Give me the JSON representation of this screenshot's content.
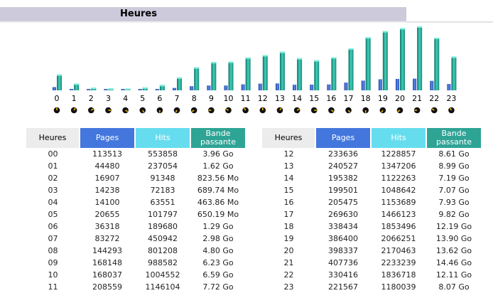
{
  "title": "Heures",
  "colors": {
    "pages": "#4477dd",
    "hits": "#2ea495",
    "header_bar": "#cccadb"
  },
  "columns": {
    "hour": "Heures",
    "pages": "Pages",
    "hits": "Hits",
    "bandwidth": "Bande passante"
  },
  "chart_data": {
    "type": "bar",
    "categories": [
      "0",
      "1",
      "2",
      "3",
      "4",
      "5",
      "6",
      "7",
      "8",
      "9",
      "10",
      "11",
      "12",
      "13",
      "14",
      "15",
      "16",
      "17",
      "18",
      "19",
      "20",
      "21",
      "22",
      "23"
    ],
    "series": [
      {
        "name": "Pages",
        "values": [
          113513,
          44480,
          16907,
          14238,
          14100,
          20655,
          36318,
          83272,
          144293,
          168148,
          168037,
          208559,
          233636,
          240527,
          195382,
          199501,
          205475,
          269630,
          338434,
          386400,
          398337,
          407736,
          330416,
          221567
        ]
      },
      {
        "name": "Hits",
        "values": [
          553858,
          237054,
          91348,
          72183,
          63551,
          101797,
          189680,
          450942,
          801208,
          988582,
          1004552,
          1146104,
          1228857,
          1347206,
          1122263,
          1048642,
          1153689,
          1466123,
          1853496,
          2066251,
          2170463,
          2233239,
          1836718,
          1180039
        ]
      }
    ],
    "icon": "clock-icon"
  },
  "left_rows": [
    {
      "hour": "00",
      "pages": "113513",
      "hits": "553858",
      "bw": "3.96 Go"
    },
    {
      "hour": "01",
      "pages": "44480",
      "hits": "237054",
      "bw": "1.62 Go"
    },
    {
      "hour": "02",
      "pages": "16907",
      "hits": "91348",
      "bw": "823.56 Mo"
    },
    {
      "hour": "03",
      "pages": "14238",
      "hits": "72183",
      "bw": "689.74 Mo"
    },
    {
      "hour": "04",
      "pages": "14100",
      "hits": "63551",
      "bw": "463.86 Mo"
    },
    {
      "hour": "05",
      "pages": "20655",
      "hits": "101797",
      "bw": "650.19 Mo"
    },
    {
      "hour": "06",
      "pages": "36318",
      "hits": "189680",
      "bw": "1.29 Go"
    },
    {
      "hour": "07",
      "pages": "83272",
      "hits": "450942",
      "bw": "2.98 Go"
    },
    {
      "hour": "08",
      "pages": "144293",
      "hits": "801208",
      "bw": "4.80 Go"
    },
    {
      "hour": "09",
      "pages": "168148",
      "hits": "988582",
      "bw": "6.23 Go"
    },
    {
      "hour": "10",
      "pages": "168037",
      "hits": "1004552",
      "bw": "6.59 Go"
    },
    {
      "hour": "11",
      "pages": "208559",
      "hits": "1146104",
      "bw": "7.72 Go"
    }
  ],
  "right_rows": [
    {
      "hour": "12",
      "pages": "233636",
      "hits": "1228857",
      "bw": "8.61 Go"
    },
    {
      "hour": "13",
      "pages": "240527",
      "hits": "1347206",
      "bw": "8.99 Go"
    },
    {
      "hour": "14",
      "pages": "195382",
      "hits": "1122263",
      "bw": "7.19 Go"
    },
    {
      "hour": "15",
      "pages": "199501",
      "hits": "1048642",
      "bw": "7.07 Go"
    },
    {
      "hour": "16",
      "pages": "205475",
      "hits": "1153689",
      "bw": "7.93 Go"
    },
    {
      "hour": "17",
      "pages": "269630",
      "hits": "1466123",
      "bw": "9.82 Go"
    },
    {
      "hour": "18",
      "pages": "338434",
      "hits": "1853496",
      "bw": "12.19 Go"
    },
    {
      "hour": "19",
      "pages": "386400",
      "hits": "2066251",
      "bw": "13.90 Go"
    },
    {
      "hour": "20",
      "pages": "398337",
      "hits": "2170463",
      "bw": "13.62 Go"
    },
    {
      "hour": "21",
      "pages": "407736",
      "hits": "2233239",
      "bw": "14.46 Go"
    },
    {
      "hour": "22",
      "pages": "330416",
      "hits": "1836718",
      "bw": "12.11 Go"
    },
    {
      "hour": "23",
      "pages": "221567",
      "hits": "1180039",
      "bw": "8.07 Go"
    }
  ]
}
